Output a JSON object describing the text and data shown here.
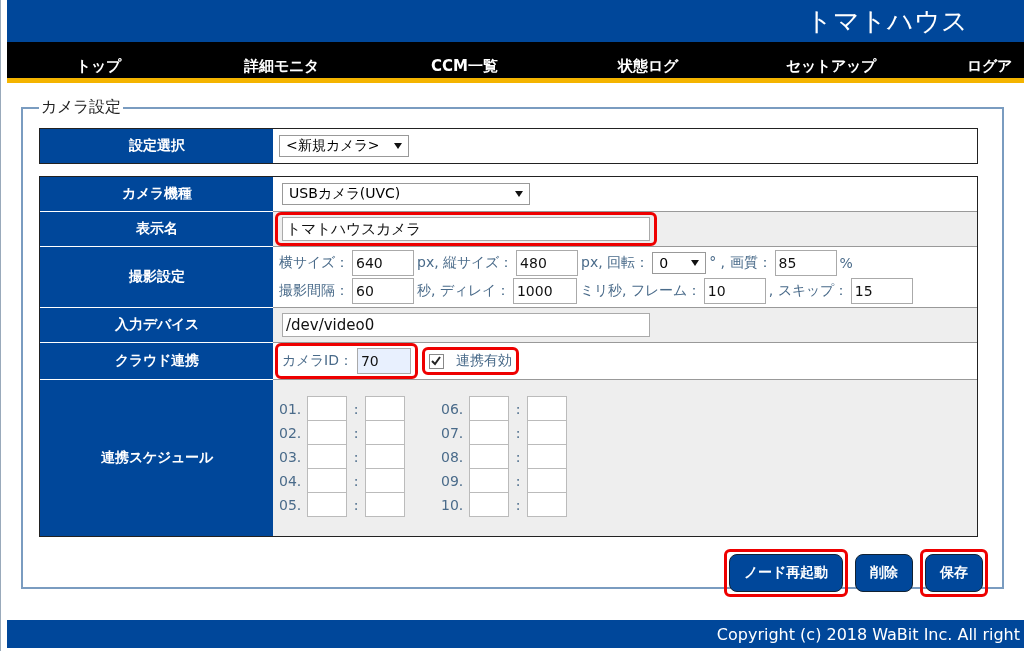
{
  "header": {
    "title": "トマトハウス"
  },
  "nav": [
    {
      "label": "トップ"
    },
    {
      "label": "詳細モニタ"
    },
    {
      "label": "CCM一覧"
    },
    {
      "label": "状態ログ"
    },
    {
      "label": "セットアップ"
    },
    {
      "label": "ログア"
    }
  ],
  "panel": {
    "legend": "カメラ設定"
  },
  "selector": {
    "label": "設定選択",
    "value": "<新規カメラ>"
  },
  "rows": [
    {
      "kind": "select",
      "label": "カメラ機種",
      "value": "USBカメラ(UVC)",
      "highlighted": false
    },
    {
      "kind": "text",
      "label": "表示名",
      "value": "トマトハウスカメラ",
      "highlighted": true
    },
    {
      "kind": "lines",
      "label": "撮影設定",
      "lines": [
        [
          {
            "kind": "label",
            "text": "横サイズ："
          },
          {
            "kind": "input",
            "value": "640"
          },
          {
            "kind": "label",
            "text": "px, 縦サイズ："
          },
          {
            "kind": "input",
            "value": "480"
          },
          {
            "kind": "label",
            "text": "px, 回転："
          },
          {
            "kind": "select",
            "value": "0"
          },
          {
            "kind": "label",
            "text": "° , 画質："
          },
          {
            "kind": "input",
            "value": "85"
          },
          {
            "kind": "label",
            "text": "%"
          }
        ],
        [
          {
            "kind": "label",
            "text": "撮影間隔："
          },
          {
            "kind": "input",
            "value": "60"
          },
          {
            "kind": "label",
            "text": "秒, ディレイ："
          },
          {
            "kind": "input",
            "value": "1000"
          },
          {
            "kind": "label",
            "text": "ミリ秒, フレーム："
          },
          {
            "kind": "input",
            "value": "10"
          },
          {
            "kind": "label",
            "text": ", スキップ："
          },
          {
            "kind": "input",
            "value": "15"
          }
        ]
      ]
    },
    {
      "kind": "text",
      "label": "入力デバイス",
      "value": "/dev/video0",
      "highlighted": false
    },
    {
      "kind": "cloud",
      "label": "クラウド連携",
      "id_label": "カメラID：",
      "id_value": "70",
      "id_highlighted": true,
      "checkbox_label": "連携有効",
      "checked": true,
      "checkbox_highlighted": true
    },
    {
      "kind": "schedule",
      "label": "連携スケジュール",
      "separator": ":",
      "slots": [
        "01.",
        "02.",
        "03.",
        "04.",
        "05.",
        "06.",
        "07.",
        "08.",
        "09.",
        "10."
      ]
    }
  ],
  "buttons": [
    {
      "label": "ノード再起動",
      "highlighted": true
    },
    {
      "label": "削除",
      "highlighted": false
    },
    {
      "label": "保存",
      "highlighted": true
    }
  ],
  "footer": {
    "text": "Copyright (c) 2018 WaBit Inc. All right"
  }
}
